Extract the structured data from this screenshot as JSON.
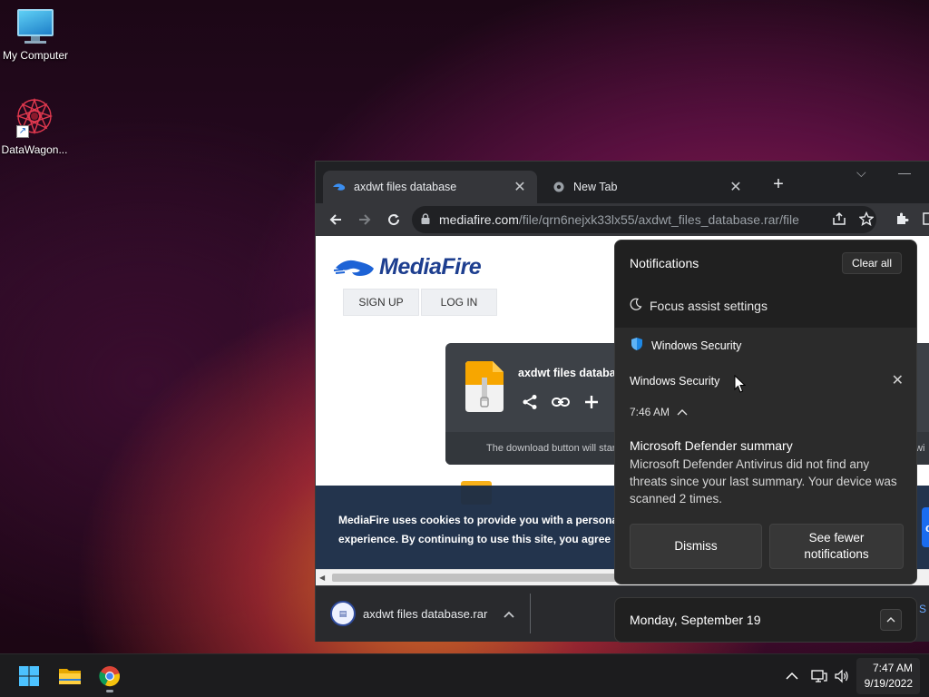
{
  "desktop": {
    "icons": [
      {
        "label": "My Computer",
        "icon": "computer-icon"
      },
      {
        "label": "DataWagon...",
        "icon": "datawagon-shortcut-icon"
      }
    ]
  },
  "browser": {
    "tabs": [
      {
        "title": "axdwt files database",
        "active": true,
        "icon": "mediafire-favicon"
      },
      {
        "title": "New Tab",
        "active": false,
        "icon": "chrome-favicon"
      }
    ],
    "address": {
      "host": "mediafire.com",
      "path": "/file/qrn6nejxk33lx55/axdwt_files_database.rar/file"
    }
  },
  "page": {
    "brand": "MediaFire",
    "signup_label": "SIGN UP",
    "login_label": "LOG IN",
    "file_name": "axdwt files databas",
    "download_hint": "The download button will star",
    "download_hint_right": "wi",
    "cookie_line1": "MediaFire uses cookies to provide you with a persona",
    "cookie_line2": "experience. By continuing to use this site, you agree",
    "cookie_accept": "cep"
  },
  "downloads": {
    "item": "axdwt files database.rar"
  },
  "notifications": {
    "header": "Notifications",
    "clear_all": "Clear all",
    "focus_assist": "Focus assist settings",
    "app_group": "Windows Security",
    "card": {
      "app": "Windows Security",
      "time": "7:46 AM",
      "title": "Microsoft Defender summary",
      "body": "Microsoft Defender Antivirus did not find any threats since your last summary. Your device was scanned 2 times.",
      "dismiss": "Dismiss",
      "fewer": "See fewer notifications"
    }
  },
  "calendar": {
    "date": "Monday, September 19"
  },
  "taskbar": {
    "time": "7:47 AM",
    "date": "9/19/2022",
    "side_peek": "S"
  },
  "colors": {
    "windows_blue": "#0078d4",
    "mediafire_blue": "#1d3e8f",
    "notif_bg": "#202020"
  }
}
